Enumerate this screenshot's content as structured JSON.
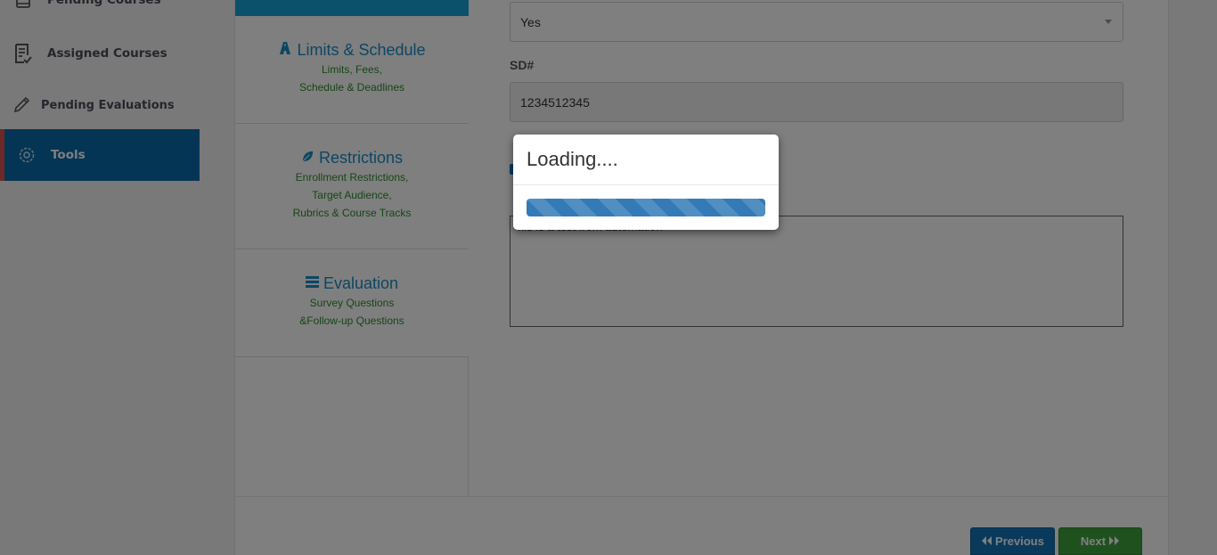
{
  "sidebar": {
    "items": [
      {
        "label": "Pending Courses",
        "icon": "book-icon"
      },
      {
        "label": "Assigned Courses",
        "icon": "assigned-list-icon"
      },
      {
        "label": "Pending Evaluations",
        "icon": "pencil-icon"
      },
      {
        "label": "Tools",
        "icon": "gear-icon",
        "active": true
      }
    ]
  },
  "wizard": {
    "steps": [
      {
        "title": "Limits & Schedule",
        "icon": "road-icon",
        "lines": [
          "Limits, Fees,",
          "Schedule & Deadlines"
        ]
      },
      {
        "title": "Restrictions",
        "icon": "leaf-icon",
        "lines": [
          "Enrollment Restrictions,",
          "Target Audience,",
          "Rubrics & Course Tracks"
        ]
      },
      {
        "title": "Evaluation",
        "icon": "tasks-icon",
        "lines": [
          "Survey Questions",
          "&Follow-up Questions"
        ]
      }
    ]
  },
  "form": {
    "select_value": "Yes",
    "sd_label": "SD#",
    "sd_value": "1234512345",
    "textarea_value": "his is a test from automation"
  },
  "buttons": {
    "previous_label": "Previous",
    "next_label": "Next"
  },
  "modal": {
    "title": "Loading....",
    "progress_percent": 100
  },
  "colors": {
    "accent_blue": "#1a8dc7",
    "sidebar_active": "#0a6aa8",
    "sidebar_active_border": "#d9534f",
    "step_subtext": "#2e8b2e",
    "previous_button": "#1474b6",
    "next_button": "#3fa33f",
    "progress_bar": "#337ab7"
  }
}
